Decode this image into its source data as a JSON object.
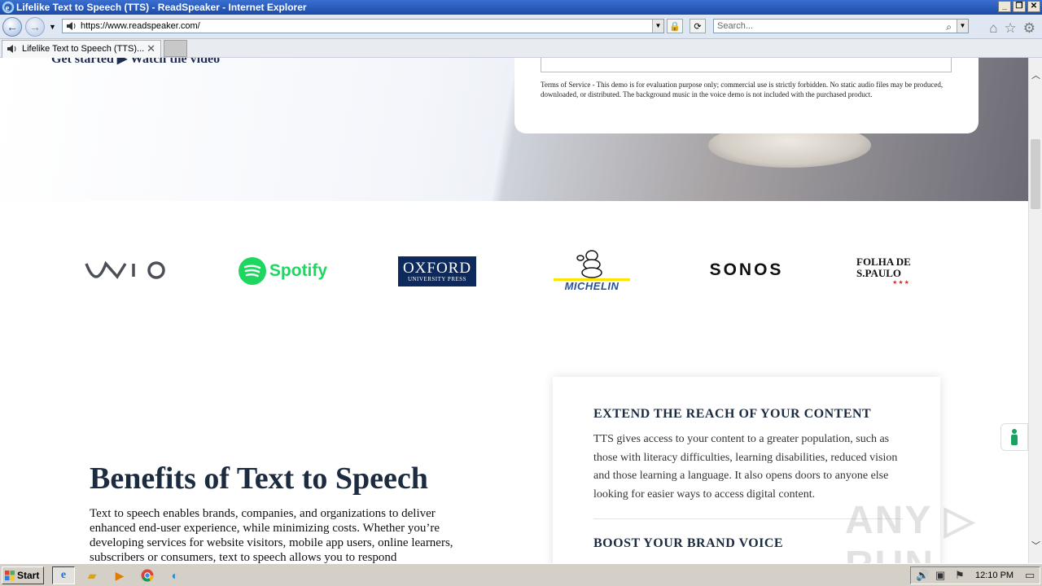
{
  "window": {
    "title": "Lifelike Text to Speech (TTS) - ReadSpeaker - Internet Explorer",
    "buttons": [
      "_",
      "❐",
      "✕"
    ]
  },
  "toolbar": {
    "url": "https://www.readspeaker.com/",
    "search_placeholder": "Search..."
  },
  "tab": {
    "label": "Lifelike Text to Speech (TTS)...",
    "close": "✕"
  },
  "hero": {
    "left_text": "Get started  ▶ Watch the video",
    "tos": "Terms of Service - This demo is for evaluation purpose only; commercial use is strictly forbidden. No static audio files may be produced, downloaded, or distributed. The background music in the voice demo is not included with the purchased product."
  },
  "logos": {
    "vaio": "VAIO",
    "spotify": "Spotify",
    "oxford_line1": "OXFORD",
    "oxford_line2": "UNIVERSITY PRESS",
    "michelin": "MICHELIN",
    "sonos": "SONOS",
    "folha": "FOLHA DE S.PAULO",
    "folha_stars": "★★★"
  },
  "benefits": {
    "title": "Benefits of Text to Speech",
    "body": "Text to speech enables brands, companies, and organizations to deliver enhanced end-user experience, while minimizing costs. Whether you’re developing services for website visitors, mobile app users, online learners, subscribers or consumers, text to speech allows you to respond"
  },
  "card": {
    "h1": "EXTEND THE REACH OF YOUR CONTENT",
    "desc": "TTS gives access to your content to a greater population, such as those with literacy difficulties, learning disabilities, reduced vision and those learning a language. It also opens doors to anyone else looking for easier ways to access digital content.",
    "h2": "BOOST YOUR BRAND VOICE"
  },
  "watermark": "ANY ▷ RUN",
  "taskbar": {
    "start": "Start",
    "clock": "12:10 PM"
  }
}
